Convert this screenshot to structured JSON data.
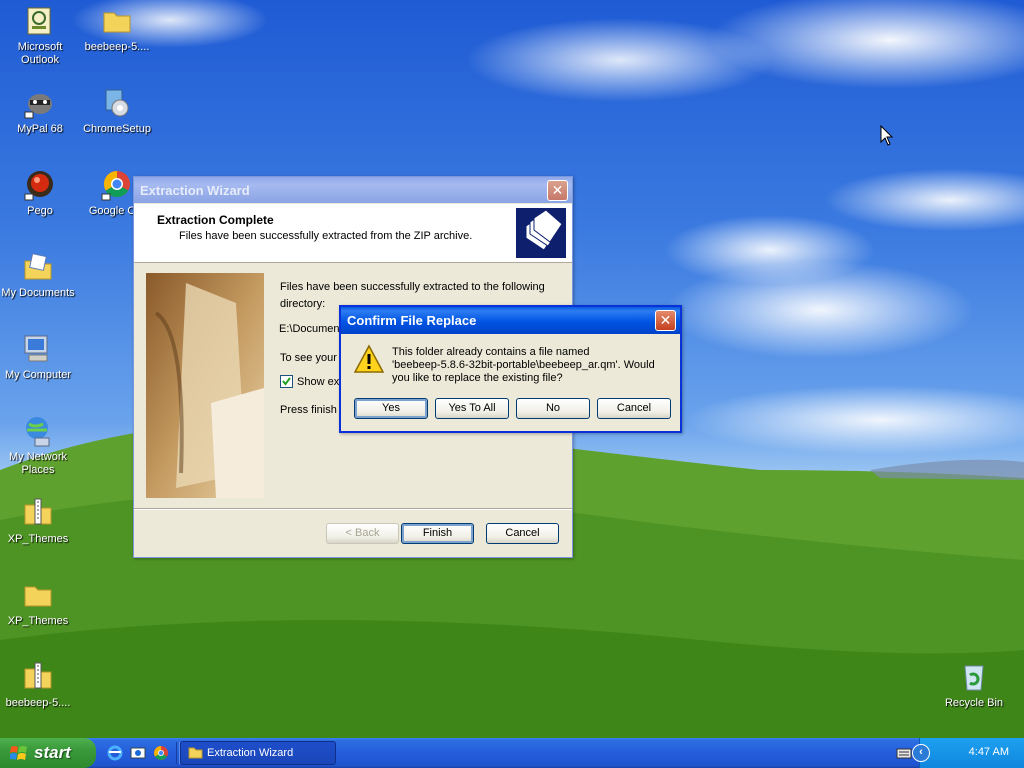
{
  "desktop": {
    "icons": [
      {
        "label": "Microsoft Outlook",
        "icon": "outlook-icon"
      },
      {
        "label": "beebeep-5....",
        "icon": "folder-icon"
      },
      {
        "label": "MyPal 68",
        "icon": "mypal-icon"
      },
      {
        "label": "ChromeSetup",
        "icon": "installer-icon"
      },
      {
        "label": "Pego",
        "icon": "pego-icon"
      },
      {
        "label": "Google Chr",
        "icon": "chrome-icon"
      },
      {
        "label": "My Documents",
        "icon": "my-documents-icon"
      },
      {
        "label": "My Computer",
        "icon": "my-computer-icon"
      },
      {
        "label": "My Network Places",
        "icon": "network-icon"
      },
      {
        "label": "XP_Themes",
        "icon": "zip-folder-icon"
      },
      {
        "label": "XP_Themes",
        "icon": "folder-icon"
      },
      {
        "label": "beebeep-5....",
        "icon": "zip-folder-icon"
      },
      {
        "label": "Recycle Bin",
        "icon": "recycle-bin-icon"
      }
    ]
  },
  "wizard": {
    "title": "Extraction Wizard",
    "header_title": "Extraction Complete",
    "header_subtitle": "Files have been successfully extracted from the ZIP archive.",
    "body_line1": "Files have been successfully extracted to the following",
    "body_line2": "directory:",
    "path": "E:\\Documen",
    "see_text": "To see your",
    "show_checkbox_label": "Show ext",
    "show_checkbox_checked": true,
    "press_finish": "Press finish t",
    "back_label": "< Back",
    "finish_label": "Finish",
    "cancel_label": "Cancel"
  },
  "dialog": {
    "title": "Confirm File Replace",
    "message_line1": "This folder already contains a file named",
    "message_line2": "'beebeep-5.8.6-32bit-portable\\beebeep_ar.qm'.  Would",
    "message_line3": "you like to replace the existing file?",
    "yes_label": "Yes",
    "yes_to_all_label": "Yes To All",
    "no_label": "No",
    "cancel_label": "Cancel"
  },
  "taskbar": {
    "start_label": "start",
    "task_label": "Extraction Wizard",
    "clock": "4:47 AM"
  }
}
